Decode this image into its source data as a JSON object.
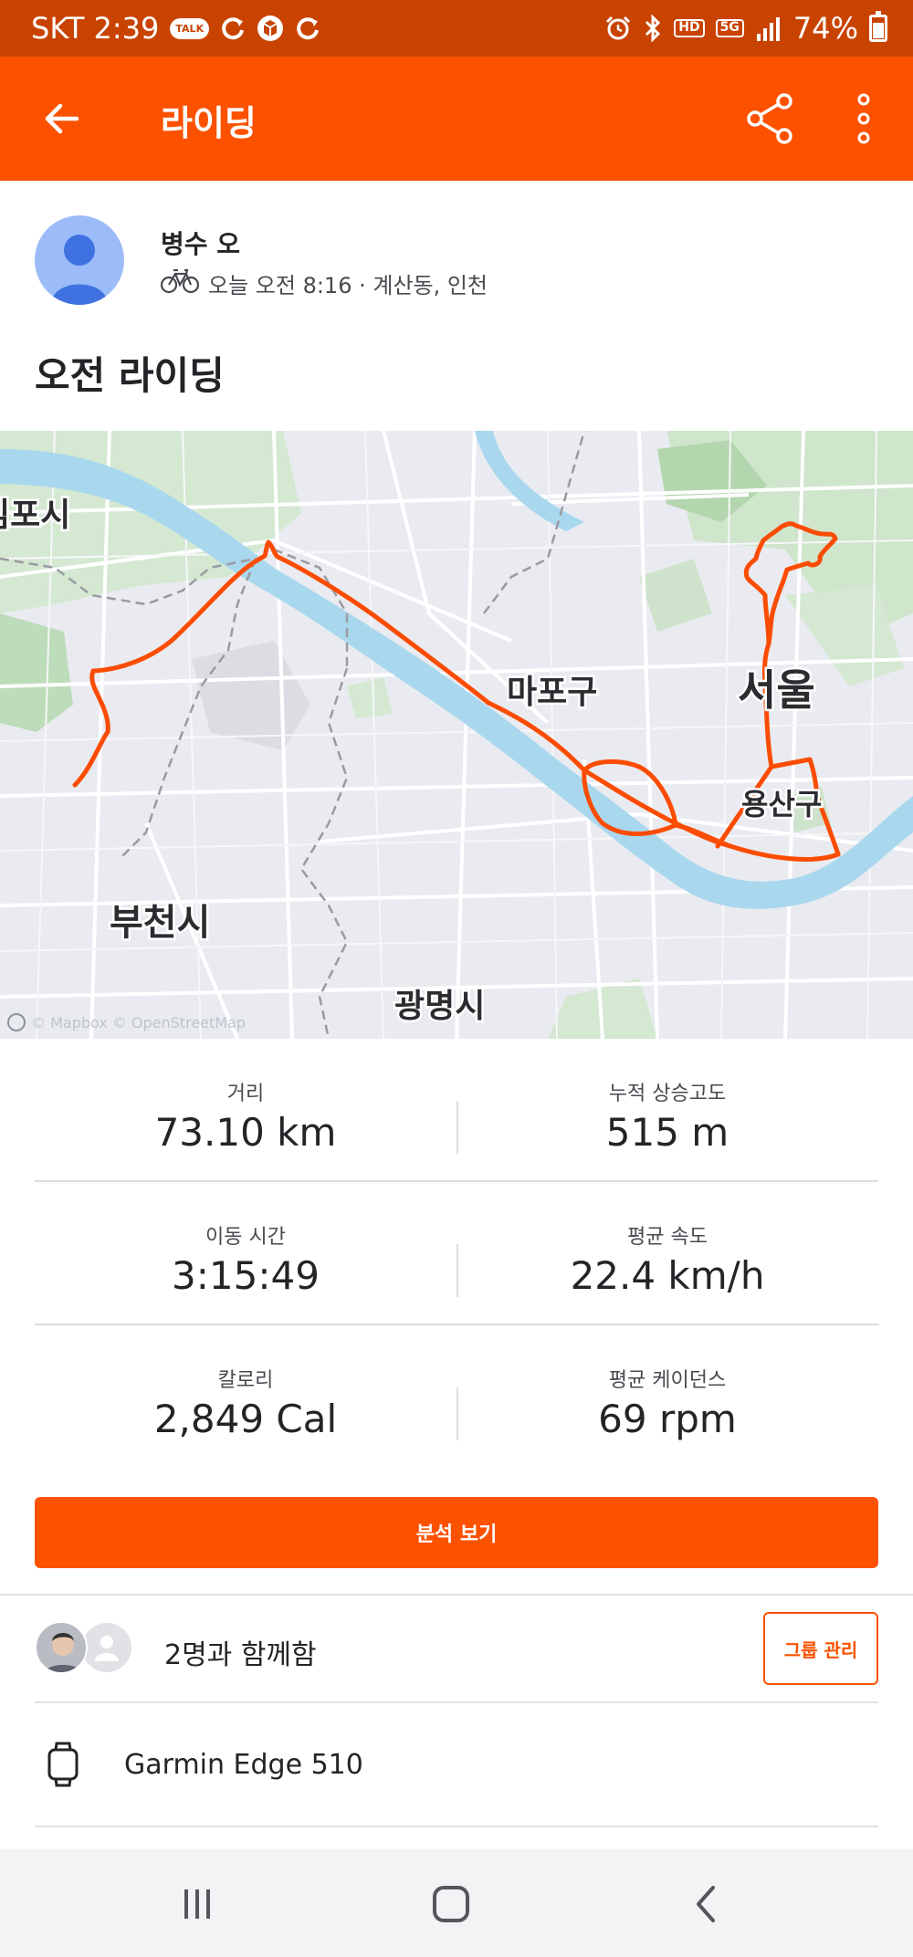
{
  "status_bar": {
    "carrier_time": "SKT 2:39",
    "talk_badge": "TALK",
    "hd_badge": "HD",
    "network": "5G",
    "battery": "74%",
    "icons": [
      "talk-icon",
      "sync-icon",
      "box-icon",
      "sync-icon",
      "alarm-icon",
      "bluetooth-icon",
      "hd-voice-icon",
      "5g-icon",
      "signal-icon",
      "battery-icon"
    ]
  },
  "app_bar": {
    "title": "라이딩",
    "icons": [
      "back-arrow-icon",
      "share-icon",
      "more-vertical-icon"
    ],
    "background": "#fc5200"
  },
  "athlete": {
    "name": "병수 오",
    "meta": "오늘 오전 8:16 · 계산동, 인천",
    "sport_icon": "bike-icon"
  },
  "activity_title": "오전 라이딩",
  "map": {
    "labels": [
      "김포시",
      "마포구",
      "서울",
      "용산구",
      "부천시",
      "광명시"
    ],
    "credit": "© Mapbox © OpenStreetMap",
    "route_color": "#fc4c02"
  },
  "stats": [
    {
      "label": "거리",
      "value": "73.10 km"
    },
    {
      "label": "누적 상승고도",
      "value": "515 m"
    },
    {
      "label": "이동 시간",
      "value": "3:15:49"
    },
    {
      "label": "평균 속도",
      "value": "22.4 km/h"
    },
    {
      "label": "칼로리",
      "value": "2,849 Cal"
    },
    {
      "label": "평균 케이던스",
      "value": "69 rpm"
    }
  ],
  "analysis_button": "분석 보기",
  "group": {
    "text": "2명과 함께함",
    "manage_button": "그룹 관리"
  },
  "device": {
    "name": "Garmin Edge 510",
    "icon": "watch-icon"
  },
  "nav_bar": {
    "icons": [
      "recent-apps-icon",
      "home-icon",
      "back-icon"
    ]
  }
}
